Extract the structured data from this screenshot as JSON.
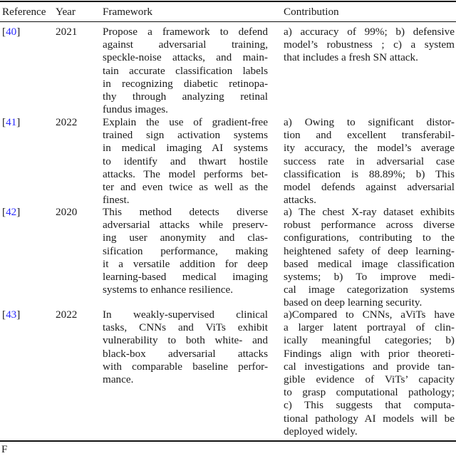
{
  "table": {
    "headers": {
      "reference": "Reference",
      "year": "Year",
      "framework": "Framework",
      "contribution": "Contribution"
    },
    "rows": [
      {
        "ref_open": "[",
        "ref_num": "40",
        "ref_close": "]",
        "year": "2021",
        "framework_lines": [
          "Propose a framework to defend",
          "against adversarial training,",
          "speckle-noise attacks, and main-",
          "tain accurate classification labels",
          "in recognizing diabetic retinopa-",
          "thy through analyzing retinal",
          "fundus images."
        ],
        "contribution_lines": [
          "a) accuracy of 99%; b) defensive",
          "model’s robustness ; c) a system",
          "that includes a fresh SN attack."
        ]
      },
      {
        "ref_open": "[",
        "ref_num": "41",
        "ref_close": "]",
        "year": "2022",
        "framework_lines": [
          "Explain the use of gradient-free",
          "trained sign activation systems",
          "in medical imaging AI systems",
          "to identify and thwart hostile",
          "attacks. The model performs bet-",
          "ter and even twice as well as the",
          "finest."
        ],
        "contribution_lines": [
          " a) Owing to significant distor-",
          "tion and excellent transferabil-",
          "ity accuracy, the model’s average",
          "success rate in adversarial case",
          "classification is 88.89%; b) This",
          "model defends against adversarial",
          "attacks."
        ]
      },
      {
        "ref_open": "[",
        "ref_num": "42",
        "ref_close": "]",
        "year": "2020",
        "framework_lines": [
          "This method detects diverse",
          "adversarial attacks while preserv-",
          "ing user anonymity and clas-",
          "sification performance, making",
          "it a versatile addition for deep",
          "learning-based medical imaging",
          "systems to enhance resilience."
        ],
        "contribution_lines": [
          "a) The chest X-ray dataset exhibits",
          "robust performance across diverse",
          "configurations, contributing to the",
          "heightened safety of deep learning-",
          "based medical image classification",
          "systems; b) To improve medi-",
          "cal image categorization systems",
          "based on deep learning security."
        ]
      },
      {
        "ref_open": "[",
        "ref_num": "43",
        "ref_close": "]",
        "year": "2022",
        "framework_lines": [
          "In weakly-supervised clinical",
          "tasks, CNNs and ViTs exhibit",
          "vulnerability to both white- and",
          "black-box adversarial attacks",
          "with comparable baseline perfor-",
          "mance."
        ],
        "contribution_lines": [
          "a)Compared to CNNs, aViTs have",
          "a larger latent portrayal of clin-",
          "ically meaningful categories; b)",
          "Findings align with prior theoreti-",
          "cal investigations and provide tan-",
          "gible evidence of ViTs’ capacity",
          "to grasp computational pathology;",
          "c) This suggests that computa-",
          "tional pathology AI models will be",
          "deployed widely."
        ]
      }
    ]
  },
  "footer": {
    "letter": "F"
  },
  "colors": {
    "link": "#2a2aff",
    "text": "#1a1a1a",
    "rule": "#111111"
  }
}
